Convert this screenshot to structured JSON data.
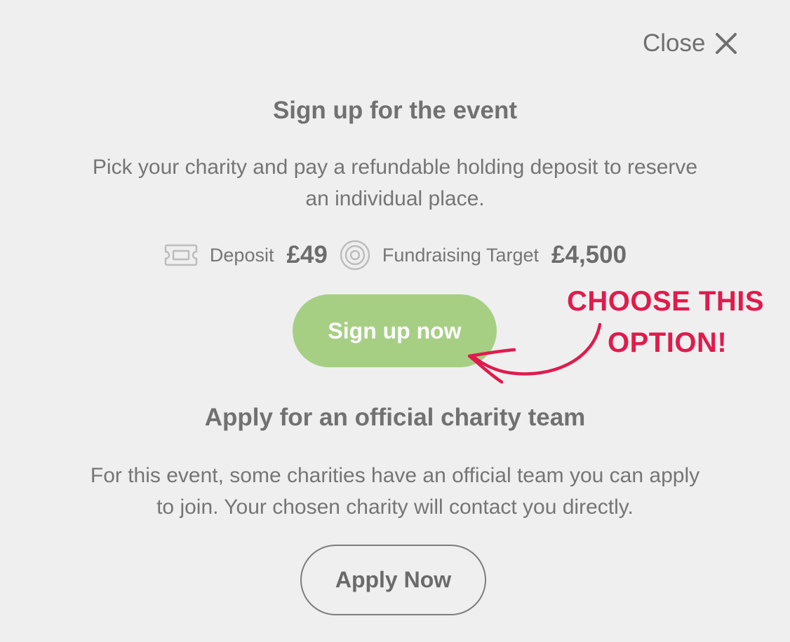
{
  "close": {
    "label": "Close"
  },
  "event_section": {
    "title": "Sign up for the event",
    "description_line1": "Pick your charity and pay a refundable holding deposit to reserve",
    "description_line2": "an individual place.",
    "deposit_label": "Deposit",
    "deposit_value": "£49",
    "target_label": "Fundraising Target",
    "target_value": "£4,500",
    "button_label": "Sign up now"
  },
  "annotation": {
    "line1": "CHOOSE THIS",
    "line2": "OPTION!",
    "color": "#e01b4c"
  },
  "team_section": {
    "title": "Apply for an official charity team",
    "description_line1": "For this event, some charities have an official team you can apply",
    "description_line2": "to join. Your chosen charity will contact you directly.",
    "button_label": "Apply Now"
  },
  "colors": {
    "background": "#efefef",
    "primary_button": "#a6cf84",
    "text": "#757575"
  },
  "icons": {
    "close": "close-icon",
    "deposit": "ticket-icon",
    "target": "target-icon",
    "annotation": "arrow-icon"
  }
}
